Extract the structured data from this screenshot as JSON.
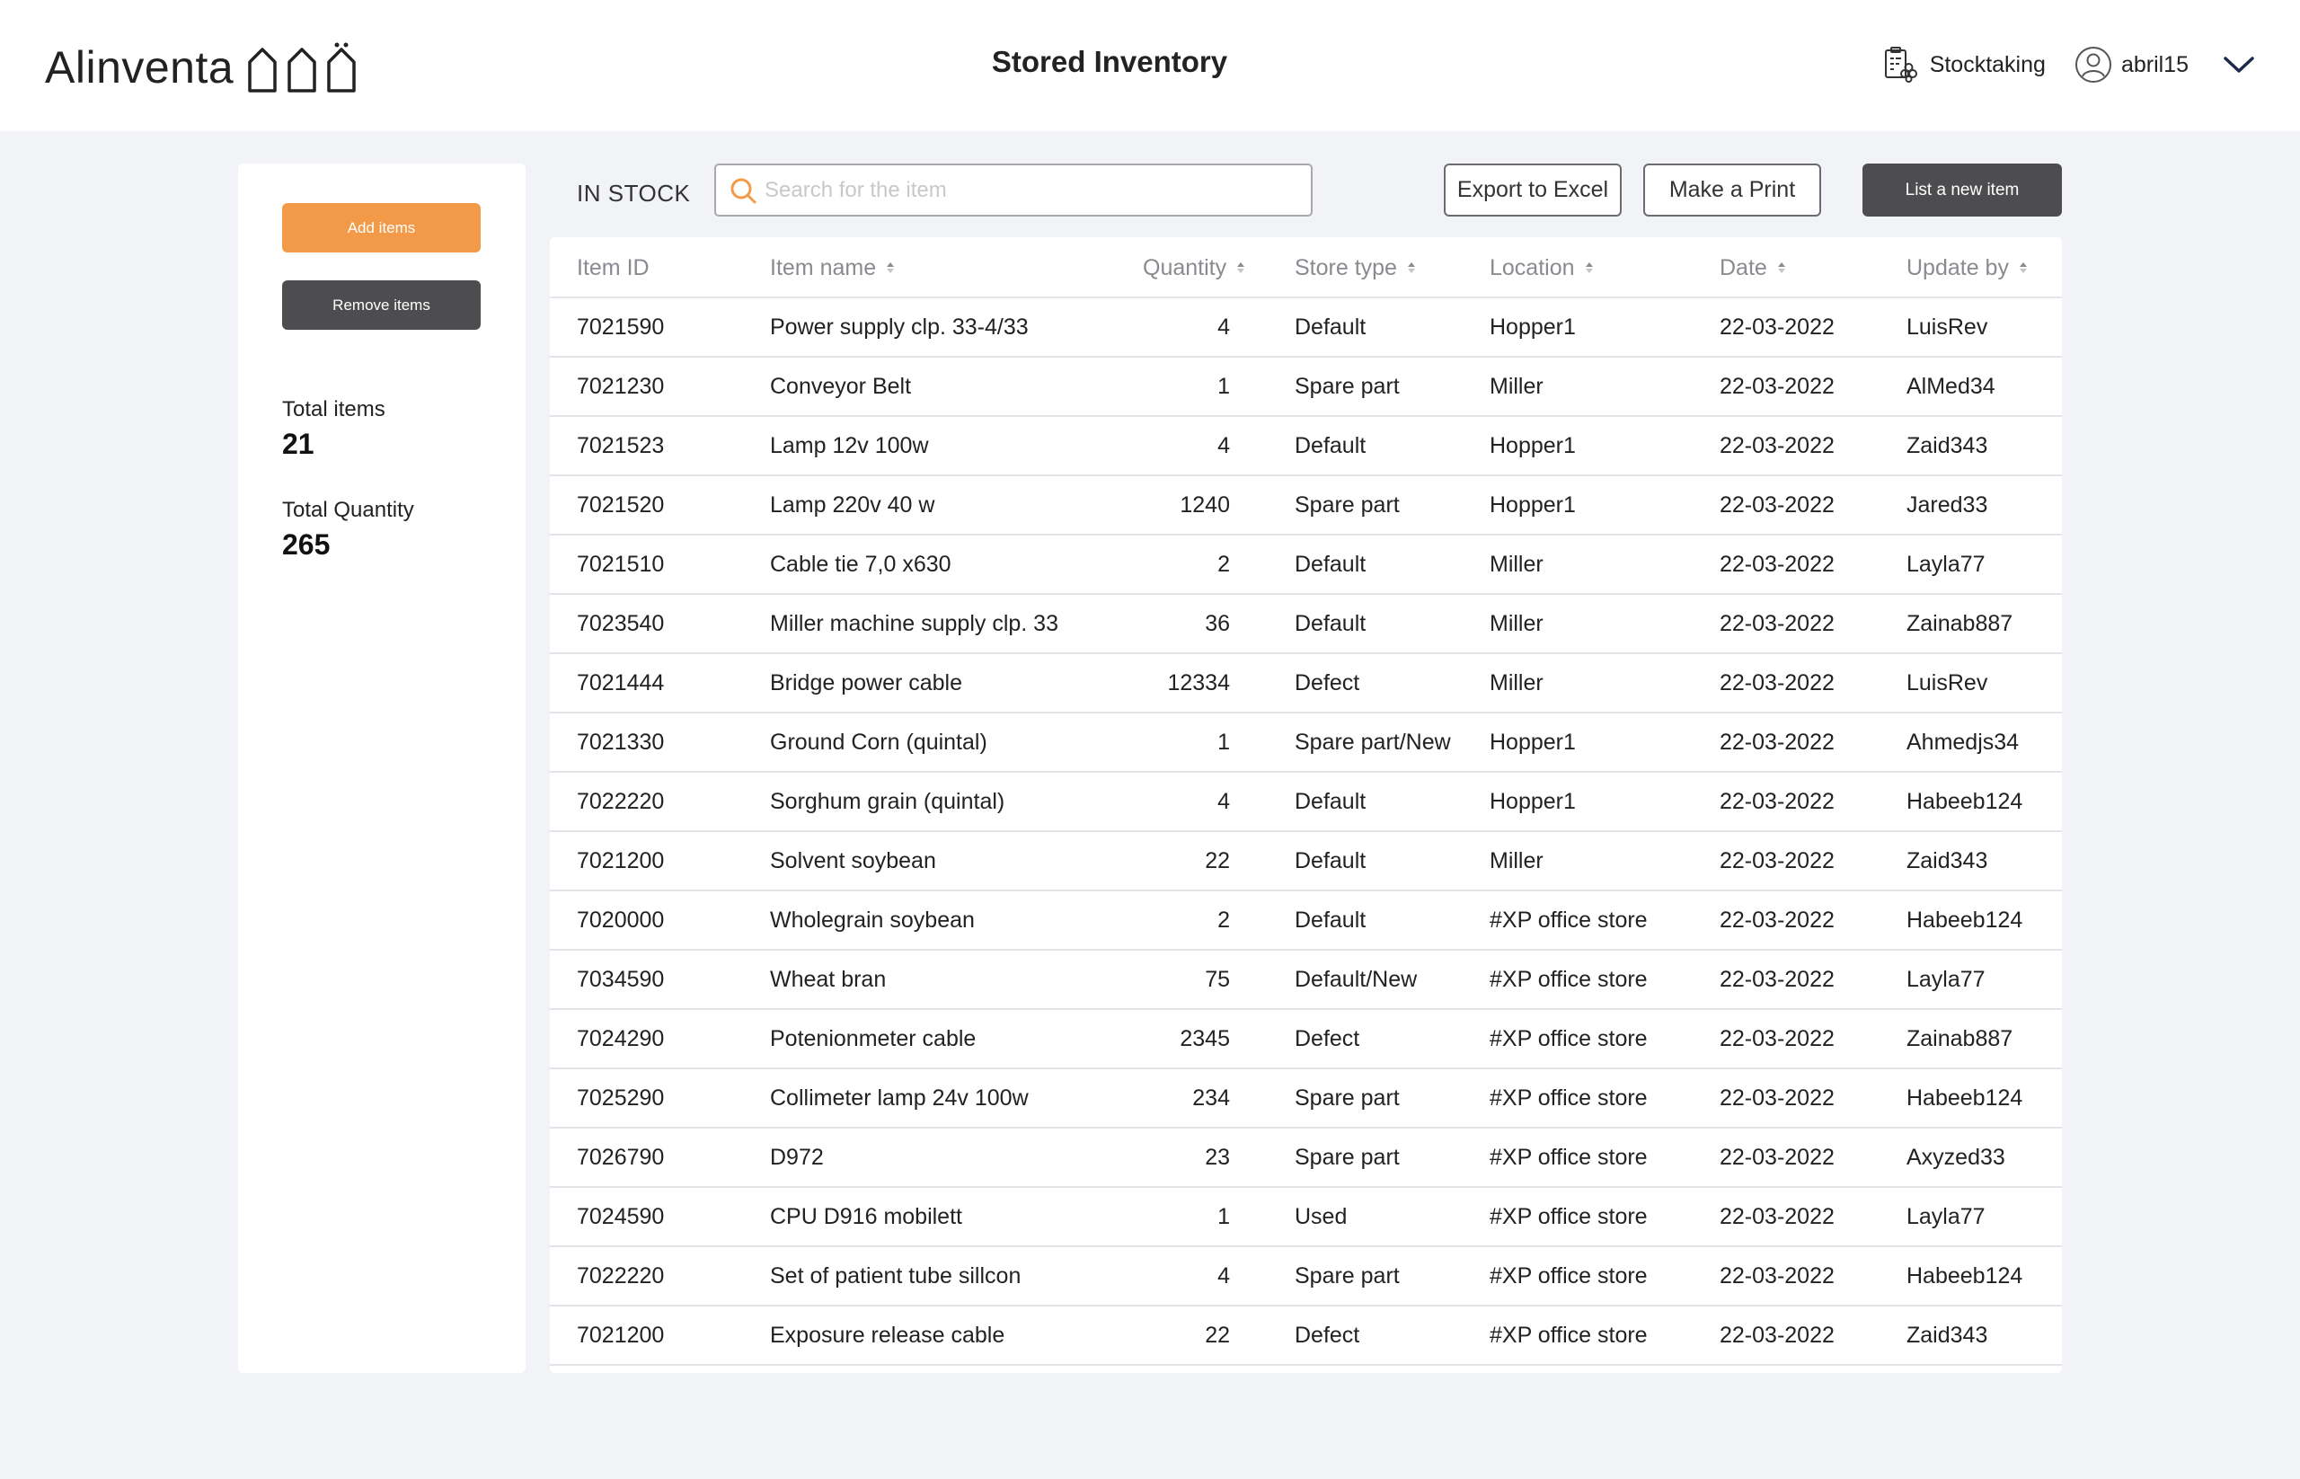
{
  "app": {
    "logo": "Alinventa",
    "page_title": "Stored Inventory"
  },
  "header": {
    "stocktaking_label": "Stocktaking",
    "username": "abril15"
  },
  "sidebar": {
    "add_label": "Add items",
    "remove_label": "Remove items",
    "total_items_label": "Total items",
    "total_items_value": "21",
    "total_quantity_label": "Total Quantity",
    "total_quantity_value": "265"
  },
  "toolbar": {
    "section_label": "IN STOCK",
    "search_placeholder": "Search for the item",
    "export_label": "Export to Excel",
    "print_label": "Make a Print",
    "new_item_label": "List a new item"
  },
  "table": {
    "columns": [
      "Item ID",
      "Item name",
      "Quantity",
      "Store type",
      "Location",
      "Date",
      "Update by"
    ],
    "rows": [
      [
        "7021590",
        "Power supply clp. 33-4/33",
        "4",
        "Default",
        "Hopper1",
        "22-03-2022",
        "LuisRev"
      ],
      [
        "7021230",
        "Conveyor Belt",
        "1",
        "Spare part",
        "Miller",
        "22-03-2022",
        "AlMed34"
      ],
      [
        "7021523",
        "Lamp 12v 100w",
        "4",
        "Default",
        "Hopper1",
        "22-03-2022",
        "Zaid343"
      ],
      [
        "7021520",
        "Lamp 220v 40 w",
        "1240",
        "Spare part",
        "Hopper1",
        "22-03-2022",
        "Jared33"
      ],
      [
        "7021510",
        "Cable tie 7,0 x630",
        "2",
        "Default",
        "Miller",
        "22-03-2022",
        "Layla77"
      ],
      [
        "7023540",
        "Miller machine supply clp. 33",
        "36",
        "Default",
        "Miller",
        "22-03-2022",
        "Zainab887"
      ],
      [
        "7021444",
        "Bridge power cable",
        "12334",
        "Defect",
        "Miller",
        "22-03-2022",
        "LuisRev"
      ],
      [
        "7021330",
        "Ground Corn (quintal)",
        "1",
        "Spare part/New",
        "Hopper1",
        "22-03-2022",
        "Ahmedjs34"
      ],
      [
        "7022220",
        "Sorghum grain (quintal)",
        "4",
        "Default",
        "Hopper1",
        "22-03-2022",
        "Habeeb124"
      ],
      [
        "7021200",
        "Solvent soybean",
        "22",
        "Default",
        "Miller",
        "22-03-2022",
        "Zaid343"
      ],
      [
        "7020000",
        "Wholegrain soybean",
        "2",
        "Default",
        "#XP office store",
        "22-03-2022",
        "Habeeb124"
      ],
      [
        "7034590",
        "Wheat bran",
        "75",
        "Default/New",
        "#XP office store",
        "22-03-2022",
        "Layla77"
      ],
      [
        "7024290",
        "Potenionmeter cable",
        "2345",
        "Defect",
        "#XP office store",
        "22-03-2022",
        "Zainab887"
      ],
      [
        "7025290",
        "Collimeter lamp 24v 100w",
        "234",
        "Spare part",
        "#XP office store",
        "22-03-2022",
        "Habeeb124"
      ],
      [
        "7026790",
        "D972",
        "23",
        "Spare part",
        "#XP office store",
        "22-03-2022",
        "Axyzed33"
      ],
      [
        "7024590",
        "CPU D916 mobilett",
        "1",
        "Used",
        "#XP office store",
        "22-03-2022",
        "Layla77"
      ],
      [
        "7022220",
        "Set of patient tube sillcon",
        "4",
        "Spare part",
        "#XP office store",
        "22-03-2022",
        "Habeeb124"
      ],
      [
        "7021200",
        "Exposure release cable",
        "22",
        "Defect",
        "#XP office store",
        "22-03-2022",
        "Zaid343"
      ]
    ]
  },
  "colors": {
    "accent": "#f39a48",
    "dark_button": "#4d4d4f",
    "background": "#f2f3f7"
  },
  "icons": [
    "houses-logo-icon",
    "stocktaking-icon",
    "user-avatar-icon",
    "chevron-down-icon",
    "search-icon",
    "sort-icon"
  ]
}
